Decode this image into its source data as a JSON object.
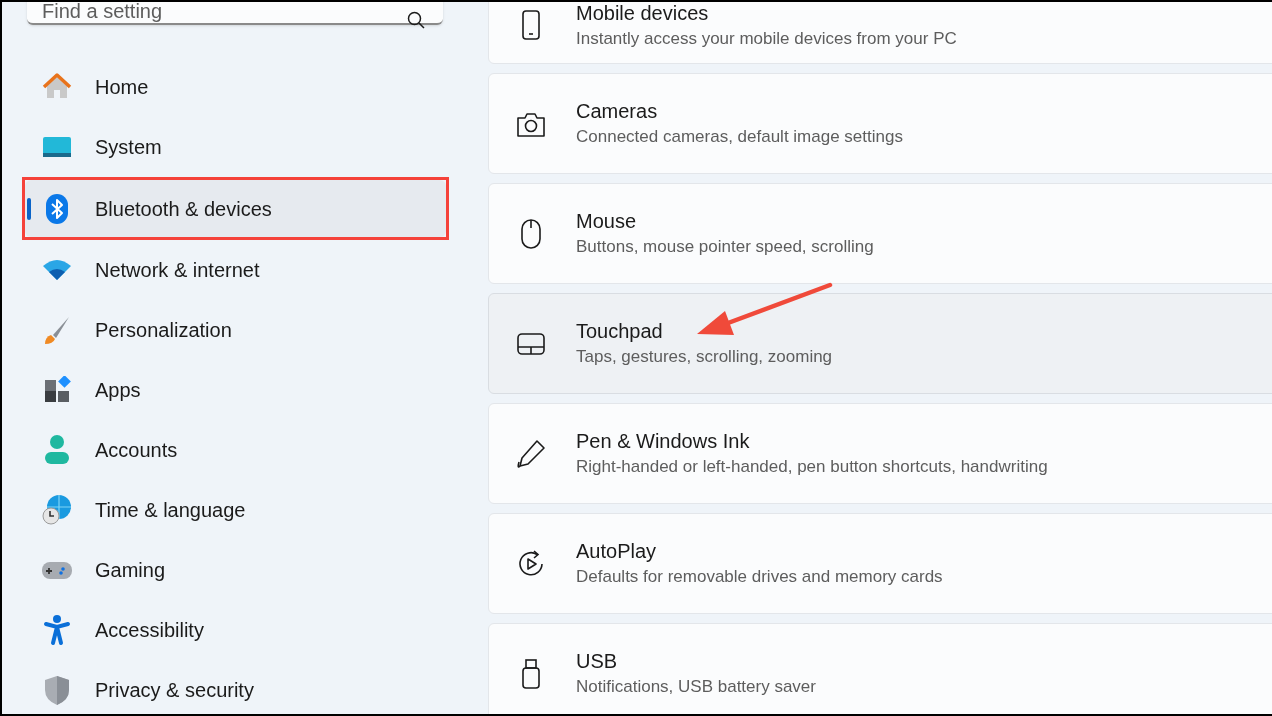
{
  "search": {
    "placeholder": "Find a setting"
  },
  "nav": [
    {
      "label": "Home",
      "kind": "home",
      "selected": false,
      "highlighted": false
    },
    {
      "label": "System",
      "kind": "system",
      "selected": false,
      "highlighted": false
    },
    {
      "label": "Bluetooth & devices",
      "kind": "bluetooth",
      "selected": true,
      "highlighted": true
    },
    {
      "label": "Network & internet",
      "kind": "network",
      "selected": false,
      "highlighted": false
    },
    {
      "label": "Personalization",
      "kind": "personalization",
      "selected": false,
      "highlighted": false
    },
    {
      "label": "Apps",
      "kind": "apps",
      "selected": false,
      "highlighted": false
    },
    {
      "label": "Accounts",
      "kind": "accounts",
      "selected": false,
      "highlighted": false
    },
    {
      "label": "Time & language",
      "kind": "time",
      "selected": false,
      "highlighted": false
    },
    {
      "label": "Gaming",
      "kind": "gaming",
      "selected": false,
      "highlighted": false
    },
    {
      "label": "Accessibility",
      "kind": "accessibility",
      "selected": false,
      "highlighted": false
    },
    {
      "label": "Privacy & security",
      "kind": "privacy",
      "selected": false,
      "highlighted": false
    }
  ],
  "cards": [
    {
      "title": "Mobile devices",
      "description": "Instantly access your mobile devices from your PC",
      "kind": "phone",
      "hovered": false,
      "arrow": false
    },
    {
      "title": "Cameras",
      "description": "Connected cameras, default image settings",
      "kind": "camera",
      "hovered": false,
      "arrow": false
    },
    {
      "title": "Mouse",
      "description": "Buttons, mouse pointer speed, scrolling",
      "kind": "mouse",
      "hovered": false,
      "arrow": false
    },
    {
      "title": "Touchpad",
      "description": "Taps, gestures, scrolling, zooming",
      "kind": "touchpad",
      "hovered": true,
      "arrow": true
    },
    {
      "title": "Pen & Windows Ink",
      "description": "Right-handed or left-handed, pen button shortcuts, handwriting",
      "kind": "pen",
      "hovered": false,
      "arrow": false
    },
    {
      "title": "AutoPlay",
      "description": "Defaults for removable drives and memory cards",
      "kind": "autoplay",
      "hovered": false,
      "arrow": false
    },
    {
      "title": "USB",
      "description": "Notifications, USB battery saver",
      "kind": "usb",
      "hovered": false,
      "arrow": false
    }
  ]
}
